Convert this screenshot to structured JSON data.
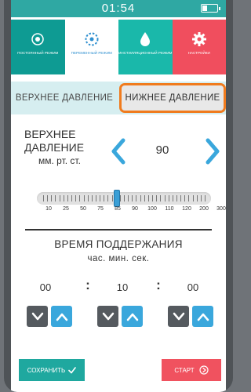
{
  "status_bar": {
    "time": "01:54"
  },
  "modes": [
    {
      "label": "постоянный режим",
      "icon": "dot-circle-icon"
    },
    {
      "label": "переменный режим",
      "icon": "dotted-circle-icon"
    },
    {
      "label": "инстилляционный режим",
      "icon": "drop-icon"
    },
    {
      "label": "настройки",
      "icon": "gear-icon"
    }
  ],
  "tabs": {
    "upper": "ВЕРХНЕЕ ДАВЛЕНИЕ",
    "lower": "НИЖНЕЕ ДАВЛЕНИЕ"
  },
  "pressure": {
    "label_line1": "ВЕРХНЕЕ",
    "label_line2": "ДАВЛЕНИЕ",
    "units": "мм. рт. ст.",
    "value": "90"
  },
  "slider": {
    "ticks": [
      "10",
      "25",
      "50",
      "75",
      "100",
      "85",
      "90",
      "100",
      "110",
      "120",
      "200",
      "300"
    ],
    "tick_labels": [
      "10",
      "25",
      "50",
      "75",
      "85",
      "90",
      "100",
      "110",
      "120",
      "200",
      "300"
    ],
    "selected_fraction": 0.46
  },
  "hold": {
    "title": "ВРЕМЯ ПОДДЕРЖАНИЯ",
    "units": "час. мин. сек.",
    "hours": "00",
    "minutes": "10",
    "seconds": "00",
    "sep1": ":",
    "sep2": ":"
  },
  "actions": {
    "save": "СОХРАНИТЬ",
    "start": "СТАРТ"
  },
  "colors": {
    "teal": "#2fa8a3",
    "accent_blue": "#3aa7dc",
    "coral": "#f04e5e",
    "highlight_orange": "#f07b1e"
  }
}
